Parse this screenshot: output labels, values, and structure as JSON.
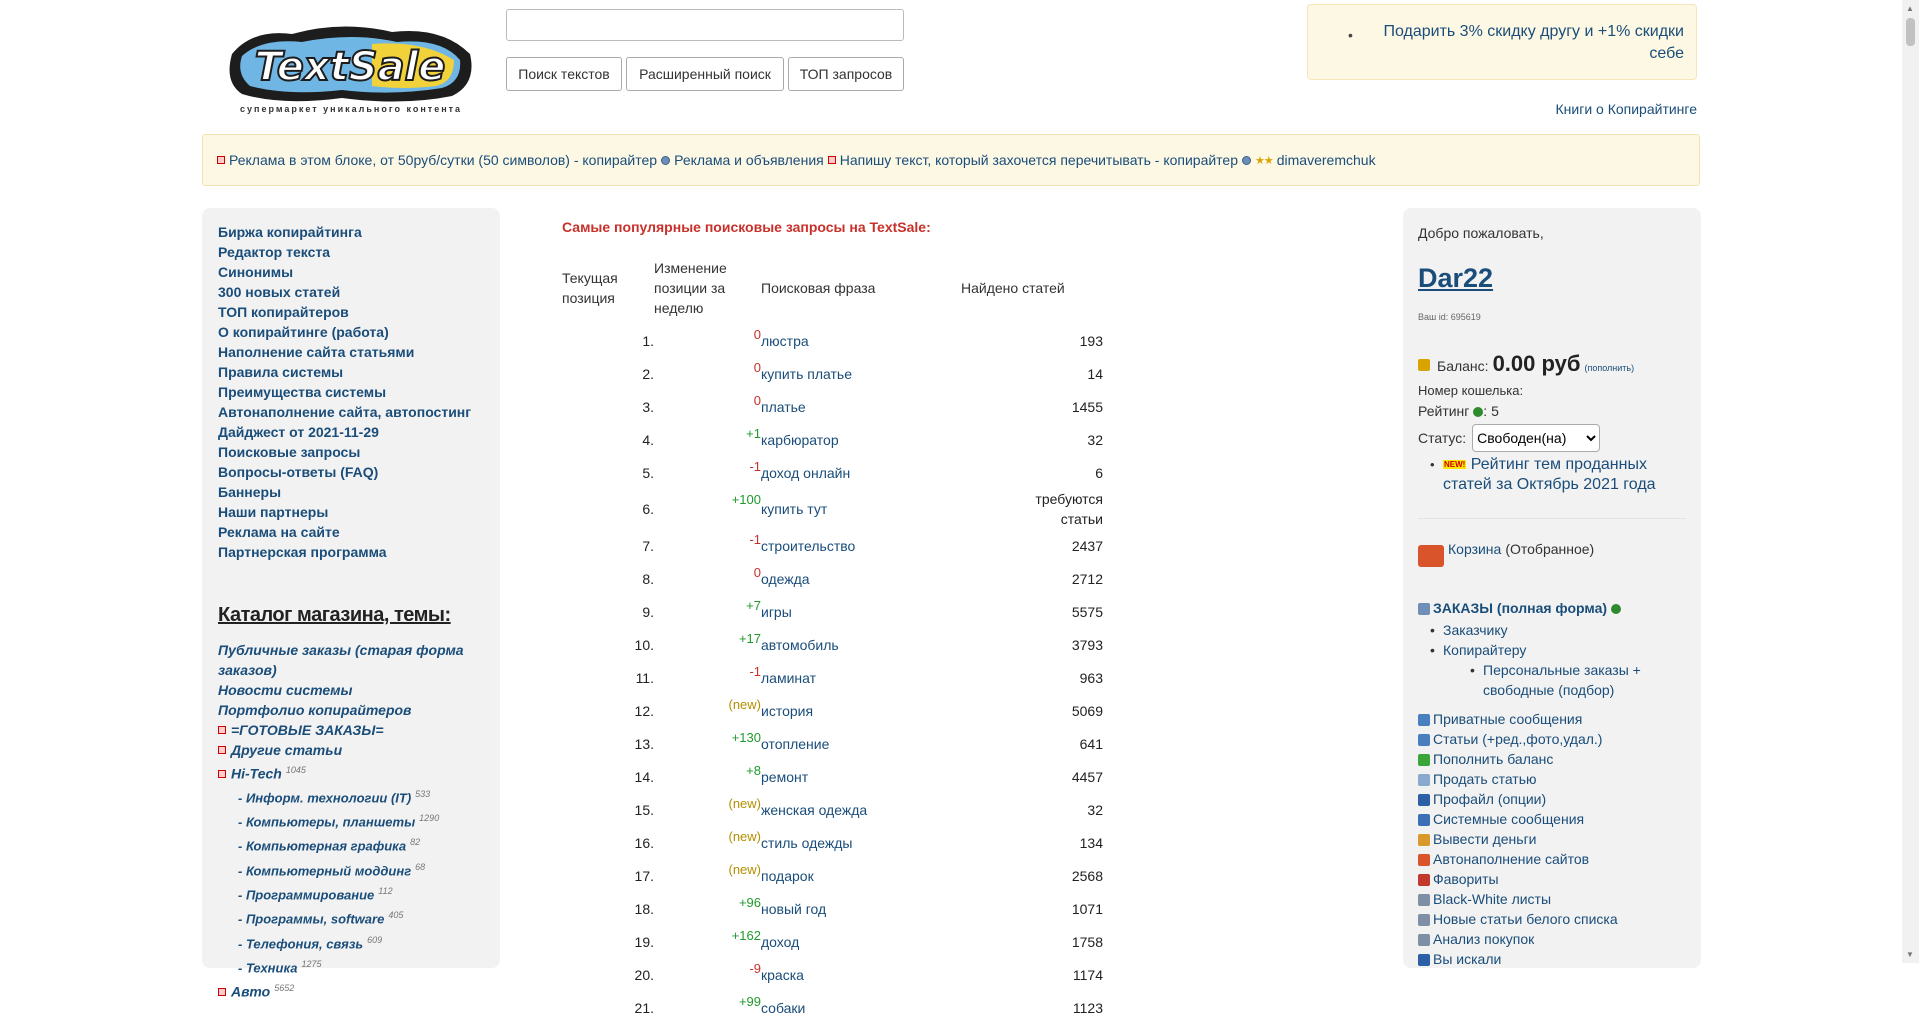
{
  "header": {
    "logo_text": "TextSale",
    "tagline": "супермаркет уникального контента",
    "search_value": "",
    "buttons": [
      "Поиск текстов",
      "Расширенный поиск",
      "ТОП запросов"
    ],
    "promo": "Подарить 3% скидку другу и +1% скидки себе",
    "books_link": "Книги о Копирайтинге"
  },
  "adbar": [
    "Реклама в этом блоке, от 50руб/сутки (50 символов) - копирайтер",
    "Реклама и объявления",
    "Напишу текст, который захочется перечитывать - копирайтер",
    "dimaveremchuk"
  ],
  "leftnav": [
    "Биржа копирайтинга",
    "Редактор текста",
    "Синонимы",
    "300 новых статей",
    "ТОП копирайтеров",
    "О копирайтинге (работа)",
    "Наполнение сайта статьями",
    "Правила системы",
    "Преимущества системы",
    "Автонаполнение сайта, автопостинг",
    "Дайджест от 2021-11-29",
    "Поисковые запросы",
    "Вопросы-ответы (FAQ)",
    "Баннеры",
    "Наши партнеры",
    "Реклама на сайте",
    "Партнерская программа"
  ],
  "catalog": {
    "title": "Каталог магазина, темы:",
    "items": [
      {
        "label": "Публичные заказы (старая форма заказов)",
        "count": "",
        "sub": false,
        "marker": false
      },
      {
        "label": "Новости системы",
        "count": "",
        "sub": false,
        "marker": false
      },
      {
        "label": "Портфолио копирайтеров",
        "count": "",
        "sub": false,
        "marker": false
      },
      {
        "label": "=ГОТОВЫЕ ЗАКАЗЫ=",
        "count": "",
        "sub": false,
        "marker": true
      },
      {
        "label": "Другие статьи",
        "count": "",
        "sub": false,
        "marker": true
      },
      {
        "label": "Hi-Tech",
        "count": "1045",
        "sub": false,
        "marker": true
      },
      {
        "label": "- Информ. технологии (IT)",
        "count": "533",
        "sub": true,
        "marker": false
      },
      {
        "label": "- Компьютеры, планшеты",
        "count": "1290",
        "sub": true,
        "marker": false
      },
      {
        "label": "- Компьютерная графика",
        "count": "82",
        "sub": true,
        "marker": false
      },
      {
        "label": "- Компьютерный моддинг",
        "count": "68",
        "sub": true,
        "marker": false
      },
      {
        "label": "- Программирование",
        "count": "112",
        "sub": true,
        "marker": false
      },
      {
        "label": "- Программы, software",
        "count": "405",
        "sub": true,
        "marker": false
      },
      {
        "label": "- Телефония, связь",
        "count": "609",
        "sub": true,
        "marker": false
      },
      {
        "label": "- Техника",
        "count": "1275",
        "sub": true,
        "marker": false
      },
      {
        "label": "Авто",
        "count": "5652",
        "sub": false,
        "marker": true
      }
    ]
  },
  "table": {
    "title": "Самые популярные поисковые запросы на TextSale:",
    "headers": [
      "Текущая позиция",
      "Изменение позиции за неделю",
      "Поисковая фраза",
      "Найдено статей"
    ],
    "rows": [
      {
        "pos": "1.",
        "chg": "0",
        "type": "zero",
        "phrase": "люстра",
        "count": "193"
      },
      {
        "pos": "2.",
        "chg": "0",
        "type": "zero",
        "phrase": "купить платье",
        "count": "14"
      },
      {
        "pos": "3.",
        "chg": "0",
        "type": "zero",
        "phrase": "платье",
        "count": "1455"
      },
      {
        "pos": "4.",
        "chg": "+1",
        "type": "up",
        "phrase": "карбюратор",
        "count": "32"
      },
      {
        "pos": "5.",
        "chg": "-1",
        "type": "down",
        "phrase": "доход онлайн",
        "count": "6"
      },
      {
        "pos": "6.",
        "chg": "+100",
        "type": "up",
        "phrase": "купить тут",
        "count": "требуются статьи"
      },
      {
        "pos": "7.",
        "chg": "-1",
        "type": "down",
        "phrase": "строительство",
        "count": "2437"
      },
      {
        "pos": "8.",
        "chg": "0",
        "type": "zero",
        "phrase": "одежда",
        "count": "2712"
      },
      {
        "pos": "9.",
        "chg": "+7",
        "type": "up",
        "phrase": "игры",
        "count": "5575"
      },
      {
        "pos": "10.",
        "chg": "+17",
        "type": "up",
        "phrase": "автомобиль",
        "count": "3793"
      },
      {
        "pos": "11.",
        "chg": "-1",
        "type": "down",
        "phrase": "ламинат",
        "count": "963"
      },
      {
        "pos": "12.",
        "chg": "(new)",
        "type": "new",
        "phrase": "история",
        "count": "5069"
      },
      {
        "pos": "13.",
        "chg": "+130",
        "type": "up",
        "phrase": "отопление",
        "count": "641"
      },
      {
        "pos": "14.",
        "chg": "+8",
        "type": "up",
        "phrase": "ремонт",
        "count": "4457"
      },
      {
        "pos": "15.",
        "chg": "(new)",
        "type": "new",
        "phrase": "женская одежда",
        "count": "32"
      },
      {
        "pos": "16.",
        "chg": "(new)",
        "type": "new",
        "phrase": "стиль одежды",
        "count": "134"
      },
      {
        "pos": "17.",
        "chg": "(new)",
        "type": "new",
        "phrase": "подарок",
        "count": "2568"
      },
      {
        "pos": "18.",
        "chg": "+96",
        "type": "up",
        "phrase": "новый год",
        "count": "1071"
      },
      {
        "pos": "19.",
        "chg": "+162",
        "type": "up",
        "phrase": "доход",
        "count": "1758"
      },
      {
        "pos": "20.",
        "chg": "-9",
        "type": "down",
        "phrase": "краска",
        "count": "1174"
      },
      {
        "pos": "21.",
        "chg": "+99",
        "type": "up",
        "phrase": "собаки",
        "count": "1123"
      }
    ]
  },
  "user": {
    "welcome": "Добро пожаловать,",
    "name": "Dar22",
    "id_text": "Ваш id: 695619",
    "balance_label": "Баланс:",
    "balance": "0.00 руб",
    "topup": "(пополнить)",
    "wallet_label": "Номер кошелька:",
    "rating_label": "Рейтинг",
    "rating_value": ": 5",
    "status_label": "Статус:",
    "status_value": "Свободен(на)",
    "new_badge": "NEW!",
    "rating_topics": "Рейтинг тем проданных статей за Октябрь 2021 года",
    "cart": "Корзина",
    "cart_note": "(Отобранное)",
    "orders": "ЗАКАЗЫ (полная форма)",
    "orders_sub": [
      "Заказчику",
      "Копирайтеру"
    ],
    "orders_sub2": "Персональные заказы + свободные (подбор)",
    "menu": [
      {
        "label": "Приватные сообщения",
        "color": "#4a7fbf"
      },
      {
        "label": "Статьи (+ред.,фото,удал.)",
        "color": "#4a7fbf"
      },
      {
        "label": "Пополнить баланс",
        "color": "#3aa53a"
      },
      {
        "label": "Продать статью",
        "color": "#8aa9cf"
      },
      {
        "label": "Профайл (опции)",
        "color": "#2d5fa6"
      },
      {
        "label": "Системные сообщения",
        "color": "#3b6fb6"
      },
      {
        "label": "Вывести деньги",
        "color": "#d99a2b"
      },
      {
        "label": "Автонаполнение сайтов",
        "color": "#d9532b"
      },
      {
        "label": "Фавориты",
        "color": "#c0392b"
      },
      {
        "label": "Black-White листы",
        "color": "#7f8fa6"
      },
      {
        "label": "Новые статьи белого списка",
        "color": "#7f8fa6"
      },
      {
        "label": "Анализ покупок",
        "color": "#7f8fa6"
      },
      {
        "label": "Вы искали",
        "color": "#2d5fa6"
      }
    ]
  }
}
